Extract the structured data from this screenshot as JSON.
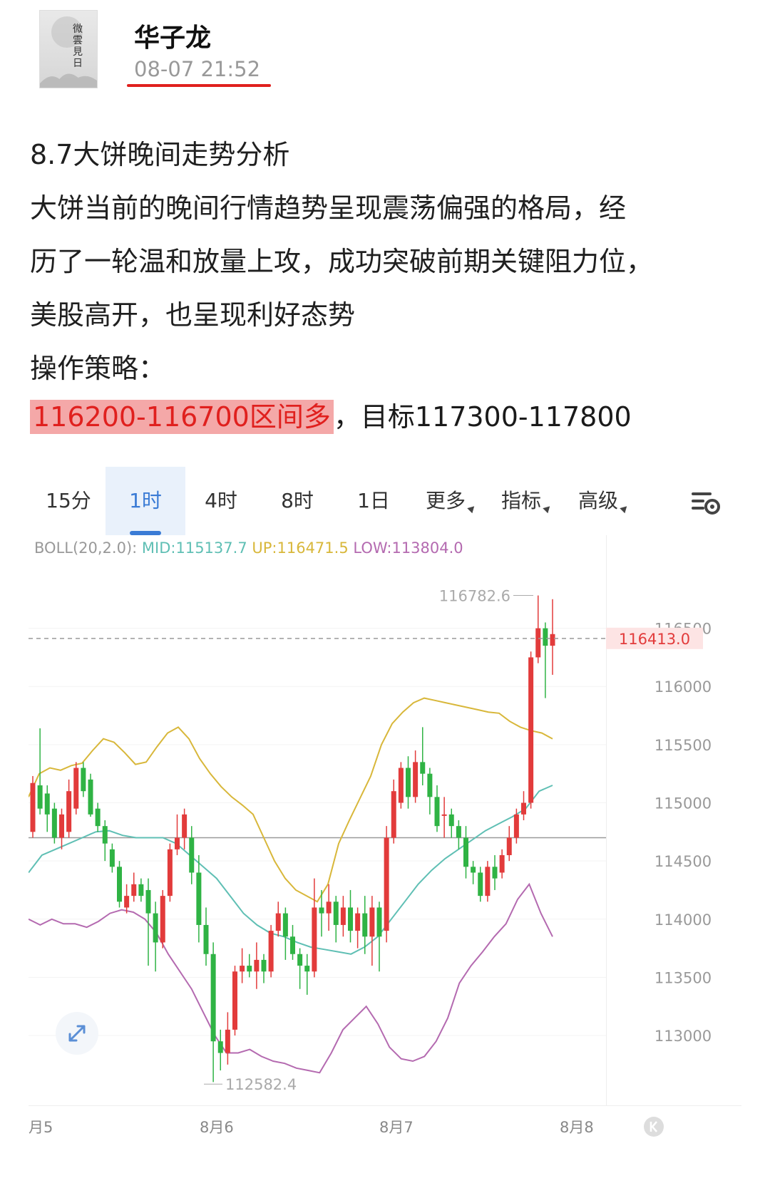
{
  "post": {
    "author": "华子龙",
    "timestamp": "08-07 21:52",
    "avatar_text": "微雲見日",
    "title": "8.7大饼晚间走势分析",
    "body_lines": [
      "大饼当前的晚间行情趋势呈现震荡偏强的格局，经",
      "历了一轮温和放量上攻，成功突破前期关键阻力位，",
      "美股高开，也呈现利好态势"
    ],
    "strategy_label": "操作策略：",
    "strategy_highlight": "116200-116700区间多",
    "strategy_rest": "，目标117300-117800"
  },
  "chart_tabs": [
    "15分",
    "1时",
    "4时",
    "8时",
    "1日",
    "更多",
    "指标",
    "高级"
  ],
  "active_tab": "1时",
  "indicator": {
    "label": "BOLL(20,2.0):",
    "mid": "MID:115137.7",
    "up": "UP:116471.5",
    "low": "LOW:113804.0"
  },
  "colors": {
    "up_candle": "#e23b3b",
    "down_candle": "#2fb344",
    "mid_line": "#5fbfb4",
    "upper_line": "#d8b73a",
    "lower_line": "#b46ab0",
    "accent": "#3a7bd5",
    "highlight_bg": "#f4a8a8",
    "highlight_text": "#e0201e"
  },
  "chart_data": {
    "type": "candlestick",
    "y_ticks": [
      "116500",
      "116000",
      "115500",
      "115000",
      "114500",
      "114000",
      "113500",
      "113000"
    ],
    "ylim": [
      112400,
      117300
    ],
    "x_labels": [
      "月5",
      "8月6",
      "8月7",
      "8月8"
    ],
    "current_price": "116413.0",
    "high_label": "116782.6",
    "low_label": "112582.4",
    "ref_price": 114700,
    "candles": [
      {
        "o": 114750,
        "c": 115170,
        "h": 115230,
        "l": 114700
      },
      {
        "o": 115150,
        "c": 114950,
        "h": 115640,
        "l": 114900
      },
      {
        "o": 115080,
        "c": 114900,
        "h": 115150,
        "l": 114750
      },
      {
        "o": 114950,
        "c": 114700,
        "h": 115000,
        "l": 114650
      },
      {
        "o": 114700,
        "c": 114900,
        "h": 114950,
        "l": 114600
      },
      {
        "o": 114750,
        "c": 115100,
        "h": 115200,
        "l": 114700
      },
      {
        "o": 114950,
        "c": 115300,
        "h": 115350,
        "l": 114900
      },
      {
        "o": 115300,
        "c": 115100,
        "h": 115350,
        "l": 115050
      },
      {
        "o": 115200,
        "c": 114900,
        "h": 115250,
        "l": 114880
      },
      {
        "o": 114950,
        "c": 114800,
        "h": 115000,
        "l": 114750
      },
      {
        "o": 114800,
        "c": 114650,
        "h": 114850,
        "l": 114500
      },
      {
        "o": 114600,
        "c": 114450,
        "h": 114650,
        "l": 114400
      },
      {
        "o": 114450,
        "c": 114150,
        "h": 114500,
        "l": 114100
      },
      {
        "o": 114100,
        "c": 114200,
        "h": 114300,
        "l": 114050
      },
      {
        "o": 114200,
        "c": 114300,
        "h": 114400,
        "l": 114150
      },
      {
        "o": 114300,
        "c": 114200,
        "h": 114350,
        "l": 114150
      },
      {
        "o": 114250,
        "c": 114050,
        "h": 114350,
        "l": 113600
      },
      {
        "o": 114050,
        "c": 113800,
        "h": 114150,
        "l": 113550
      },
      {
        "o": 113800,
        "c": 114200,
        "h": 114250,
        "l": 113750
      },
      {
        "o": 114200,
        "c": 114600,
        "h": 114650,
        "l": 114150
      },
      {
        "o": 114600,
        "c": 114700,
        "h": 114900,
        "l": 114550
      },
      {
        "o": 114700,
        "c": 114900,
        "h": 114950,
        "l": 114600
      },
      {
        "o": 114700,
        "c": 114400,
        "h": 114800,
        "l": 114300
      },
      {
        "o": 114400,
        "c": 113950,
        "h": 114550,
        "l": 113800
      },
      {
        "o": 113950,
        "c": 113700,
        "h": 114100,
        "l": 113600
      },
      {
        "o": 113700,
        "c": 112950,
        "h": 113800,
        "l": 112600
      },
      {
        "o": 112950,
        "c": 112850,
        "h": 113050,
        "l": 112700
      },
      {
        "o": 112850,
        "c": 113050,
        "h": 113200,
        "l": 112750
      },
      {
        "o": 113050,
        "c": 113550,
        "h": 113600,
        "l": 113000
      },
      {
        "o": 113550,
        "c": 113600,
        "h": 113750,
        "l": 113450
      },
      {
        "o": 113600,
        "c": 113550,
        "h": 113700,
        "l": 113500
      },
      {
        "o": 113550,
        "c": 113650,
        "h": 113800,
        "l": 113400
      },
      {
        "o": 113650,
        "c": 113550,
        "h": 113700,
        "l": 113450
      },
      {
        "o": 113550,
        "c": 113900,
        "h": 113950,
        "l": 113500
      },
      {
        "o": 113900,
        "c": 114050,
        "h": 114150,
        "l": 113850
      },
      {
        "o": 114050,
        "c": 113850,
        "h": 114100,
        "l": 113650
      },
      {
        "o": 113850,
        "c": 113700,
        "h": 113950,
        "l": 113650
      },
      {
        "o": 113700,
        "c": 113600,
        "h": 113750,
        "l": 113400
      },
      {
        "o": 113600,
        "c": 113550,
        "h": 113700,
        "l": 113350
      },
      {
        "o": 113550,
        "c": 114100,
        "h": 114350,
        "l": 113500
      },
      {
        "o": 114100,
        "c": 114050,
        "h": 114250,
        "l": 113850
      },
      {
        "o": 114050,
        "c": 114150,
        "h": 114300,
        "l": 113900
      },
      {
        "o": 114150,
        "c": 113950,
        "h": 114200,
        "l": 113800
      },
      {
        "o": 113950,
        "c": 114100,
        "h": 114200,
        "l": 113850
      },
      {
        "o": 114100,
        "c": 113900,
        "h": 114250,
        "l": 113800
      },
      {
        "o": 113900,
        "c": 114050,
        "h": 114100,
        "l": 113750
      },
      {
        "o": 114050,
        "c": 113850,
        "h": 114200,
        "l": 113700
      },
      {
        "o": 113850,
        "c": 114100,
        "h": 114200,
        "l": 113600
      },
      {
        "o": 114100,
        "c": 113850,
        "h": 114150,
        "l": 113550
      },
      {
        "o": 113900,
        "c": 114700,
        "h": 114800,
        "l": 113800
      },
      {
        "o": 114700,
        "c": 115100,
        "h": 115200,
        "l": 114650
      },
      {
        "o": 115000,
        "c": 115300,
        "h": 115350,
        "l": 114950
      },
      {
        "o": 115300,
        "c": 115050,
        "h": 115400,
        "l": 114950
      },
      {
        "o": 115050,
        "c": 115350,
        "h": 115450,
        "l": 115000
      },
      {
        "o": 115350,
        "c": 115250,
        "h": 115650,
        "l": 115150
      },
      {
        "o": 115250,
        "c": 115050,
        "h": 115300,
        "l": 114900
      },
      {
        "o": 115050,
        "c": 114800,
        "h": 115150,
        "l": 114750
      },
      {
        "o": 114900,
        "c": 114900,
        "h": 115050,
        "l": 114700
      },
      {
        "o": 114900,
        "c": 114800,
        "h": 114950,
        "l": 114700
      },
      {
        "o": 114800,
        "c": 114700,
        "h": 114850,
        "l": 114600
      },
      {
        "o": 114700,
        "c": 114450,
        "h": 114800,
        "l": 114350
      },
      {
        "o": 114450,
        "c": 114400,
        "h": 114500,
        "l": 114300
      },
      {
        "o": 114400,
        "c": 114200,
        "h": 114450,
        "l": 114150
      },
      {
        "o": 114200,
        "c": 114450,
        "h": 114500,
        "l": 114150
      },
      {
        "o": 114450,
        "c": 114350,
        "h": 114550,
        "l": 114250
      },
      {
        "o": 114400,
        "c": 114550,
        "h": 114600,
        "l": 114350
      },
      {
        "o": 114550,
        "c": 114700,
        "h": 114800,
        "l": 114500
      },
      {
        "o": 114700,
        "c": 114900,
        "h": 114950,
        "l": 114650
      },
      {
        "o": 114900,
        "c": 115000,
        "h": 115100,
        "l": 114850
      },
      {
        "o": 115000,
        "c": 116250,
        "h": 116300,
        "l": 114950
      },
      {
        "o": 116250,
        "c": 116500,
        "h": 116782,
        "l": 116200
      },
      {
        "o": 116500,
        "c": 116350,
        "h": 116550,
        "l": 115900
      },
      {
        "o": 116350,
        "c": 116450,
        "h": 116750,
        "l": 116100
      }
    ],
    "upper_band": [
      115050,
      115250,
      115300,
      115280,
      115320,
      115340,
      115450,
      115550,
      115520,
      115430,
      115330,
      115350,
      115480,
      115600,
      115650,
      115550,
      115380,
      115250,
      115140,
      115050,
      114980,
      114900,
      114700,
      114500,
      114350,
      114250,
      114200,
      114150,
      114300,
      114650,
      114850,
      115040,
      115230,
      115500,
      115680,
      115780,
      115860,
      115900,
      115880,
      115860,
      115840,
      115820,
      115800,
      115780,
      115770,
      115700,
      115650,
      115620,
      115600,
      115550
    ],
    "mid_band": [
      114400,
      114550,
      114600,
      114650,
      114700,
      114750,
      114760,
      114720,
      114700,
      114700,
      114700,
      114650,
      114550,
      114450,
      114350,
      114200,
      114050,
      113950,
      113880,
      113850,
      113800,
      113760,
      113740,
      113720,
      113700,
      113760,
      113850,
      114000,
      114150,
      114300,
      114420,
      114520,
      114600,
      114680,
      114760,
      114820,
      114880,
      114950,
      115100,
      115150
    ],
    "lower_band": [
      114000,
      113950,
      114000,
      113960,
      113960,
      113930,
      113980,
      114050,
      114080,
      114060,
      114000,
      113880,
      113700,
      113550,
      113400,
      113200,
      113000,
      112850,
      112850,
      112880,
      112820,
      112780,
      112760,
      112720,
      112700,
      112680,
      112850,
      113050,
      113150,
      113250,
      113100,
      112900,
      112800,
      112780,
      112820,
      112950,
      113150,
      113450,
      113600,
      113720,
      113850,
      113960,
      114170,
      114300,
      114050,
      113850
    ]
  }
}
